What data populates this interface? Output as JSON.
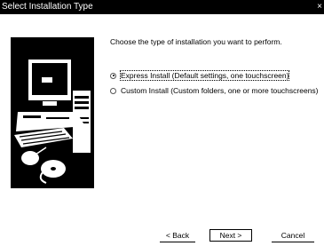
{
  "window": {
    "title": "Select Installation Type",
    "close_glyph": "×"
  },
  "main": {
    "prompt": "Choose the type of installation you want to perform.",
    "options": [
      {
        "label": "Express Install (Default settings, one touchscreen)",
        "checked": true
      },
      {
        "label": "Custom Install (Custom folders, one or more touchscreens)",
        "checked": false
      }
    ]
  },
  "buttons": {
    "back_label": "< Back",
    "next_label": "Next >",
    "cancel_label": "Cancel"
  },
  "art": {
    "icon": "computer-illustration"
  }
}
